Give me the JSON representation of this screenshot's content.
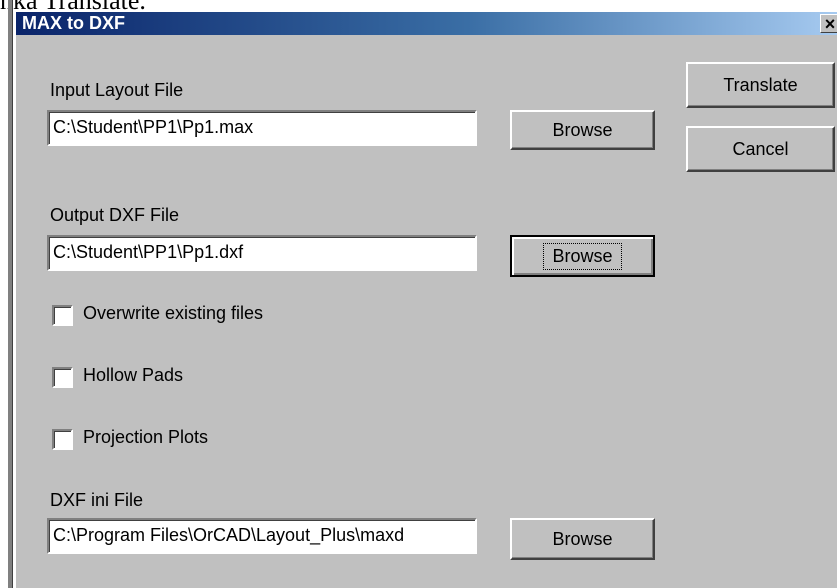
{
  "background_text": "nka Translate.",
  "window": {
    "title": "MAX to DXF",
    "close_glyph": "×"
  },
  "input_layout": {
    "label": "Input Layout File",
    "value": "C:\\Student\\PP1\\Pp1.max",
    "browse_label": "Browse"
  },
  "output_dxf": {
    "label": "Output DXF File",
    "value": "C:\\Student\\PP1\\Pp1.dxf",
    "browse_label": "Browse"
  },
  "options": [
    {
      "label": "Overwrite existing files",
      "checked": false
    },
    {
      "label": "Hollow Pads",
      "checked": false
    },
    {
      "label": "Projection Plots",
      "checked": false
    }
  ],
  "dxf_ini": {
    "label": "DXF ini File",
    "value": "C:\\Program Files\\OrCAD\\Layout_Plus\\maxd",
    "browse_label": "Browse"
  },
  "actions": {
    "translate_label": "Translate",
    "cancel_label": "Cancel"
  }
}
